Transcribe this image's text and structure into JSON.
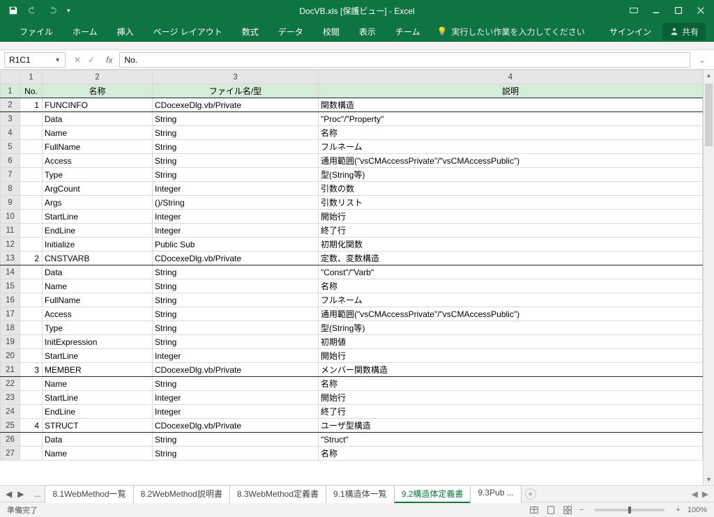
{
  "window": {
    "title": "DocVB.xls  [保護ビュー] - Excel"
  },
  "ribbon": {
    "tabs": [
      "ファイル",
      "ホーム",
      "挿入",
      "ページ レイアウト",
      "数式",
      "データ",
      "校閲",
      "表示",
      "チーム"
    ],
    "tell_me": "実行したい作業を入力してください",
    "signin": "サインイン",
    "share": "共有"
  },
  "formula_bar": {
    "name_box": "R1C1",
    "formula": "No."
  },
  "columns": {
    "indices": [
      "1",
      "2",
      "3",
      "4"
    ],
    "headers": [
      "No.",
      "名称",
      "ファイル名/型",
      "説明"
    ]
  },
  "rows": [
    {
      "no": "1",
      "name": "FUNCINFO",
      "type": "CDocexeDlg.vb/Private",
      "desc": "関数構造",
      "sect": true
    },
    {
      "no": "",
      "name": "Data",
      "type": "String",
      "desc": "\"Proc\"/\"Property\""
    },
    {
      "no": "",
      "name": "Name",
      "type": "String",
      "desc": "名称"
    },
    {
      "no": "",
      "name": "FullName",
      "type": "String",
      "desc": "フルネーム"
    },
    {
      "no": "",
      "name": "Access",
      "type": "String",
      "desc": "通用範囲(\"vsCMAccessPrivate\"/\"vsCMAccessPublic\")"
    },
    {
      "no": "",
      "name": "Type",
      "type": "String",
      "desc": "型(String等)"
    },
    {
      "no": "",
      "name": "ArgCount",
      "type": "Integer",
      "desc": "引数の数"
    },
    {
      "no": "",
      "name": "Args",
      "type": "()/String",
      "desc": "引数リスト"
    },
    {
      "no": "",
      "name": "StartLine",
      "type": "Integer",
      "desc": "開始行"
    },
    {
      "no": "",
      "name": "EndLine",
      "type": "Integer",
      "desc": "終了行"
    },
    {
      "no": "",
      "name": "Initialize",
      "type": "Public Sub",
      "desc": "初期化関数"
    },
    {
      "no": "2",
      "name": "CNSTVARB",
      "type": "CDocexeDlg.vb/Private",
      "desc": "定数、変数構造",
      "sect": true
    },
    {
      "no": "",
      "name": "Data",
      "type": "String",
      "desc": "\"Const\"/\"Varb\""
    },
    {
      "no": "",
      "name": "Name",
      "type": "String",
      "desc": "名称"
    },
    {
      "no": "",
      "name": "FullName",
      "type": "String",
      "desc": "フルネーム"
    },
    {
      "no": "",
      "name": "Access",
      "type": "String",
      "desc": "通用範囲(\"vsCMAccessPrivate\"/\"vsCMAccessPublic\")"
    },
    {
      "no": "",
      "name": "Type",
      "type": "String",
      "desc": "型(String等)"
    },
    {
      "no": "",
      "name": "InitExpression",
      "type": "String",
      "desc": "初期値"
    },
    {
      "no": "",
      "name": "StartLine",
      "type": "Integer",
      "desc": "開始行"
    },
    {
      "no": "3",
      "name": "MEMBER",
      "type": "CDocexeDlg.vb/Private",
      "desc": "メンバー関数構造",
      "sect": true
    },
    {
      "no": "",
      "name": "Name",
      "type": "String",
      "desc": "名称"
    },
    {
      "no": "",
      "name": "StartLine",
      "type": "Integer",
      "desc": "開始行"
    },
    {
      "no": "",
      "name": "EndLine",
      "type": "Integer",
      "desc": "終了行"
    },
    {
      "no": "4",
      "name": "STRUCT",
      "type": "CDocexeDlg.vb/Private",
      "desc": "ユーザ型構造",
      "sect": true
    },
    {
      "no": "",
      "name": "Data",
      "type": "String",
      "desc": "\"Struct\""
    },
    {
      "no": "",
      "name": "Name",
      "type": "String",
      "desc": "名称"
    }
  ],
  "sheet_tabs": {
    "items": [
      {
        "label": "8.1WebMethod一覧",
        "active": false
      },
      {
        "label": "8.2WebMethod説明書",
        "active": false
      },
      {
        "label": "8.3WebMethod定義書",
        "active": false
      },
      {
        "label": "9.1構造体一覧",
        "active": false
      },
      {
        "label": "9.2構造体定義書",
        "active": true
      },
      {
        "label": "9.3Pub ...",
        "active": false
      }
    ]
  },
  "status": {
    "ready": "準備完了",
    "zoom": "100%"
  }
}
